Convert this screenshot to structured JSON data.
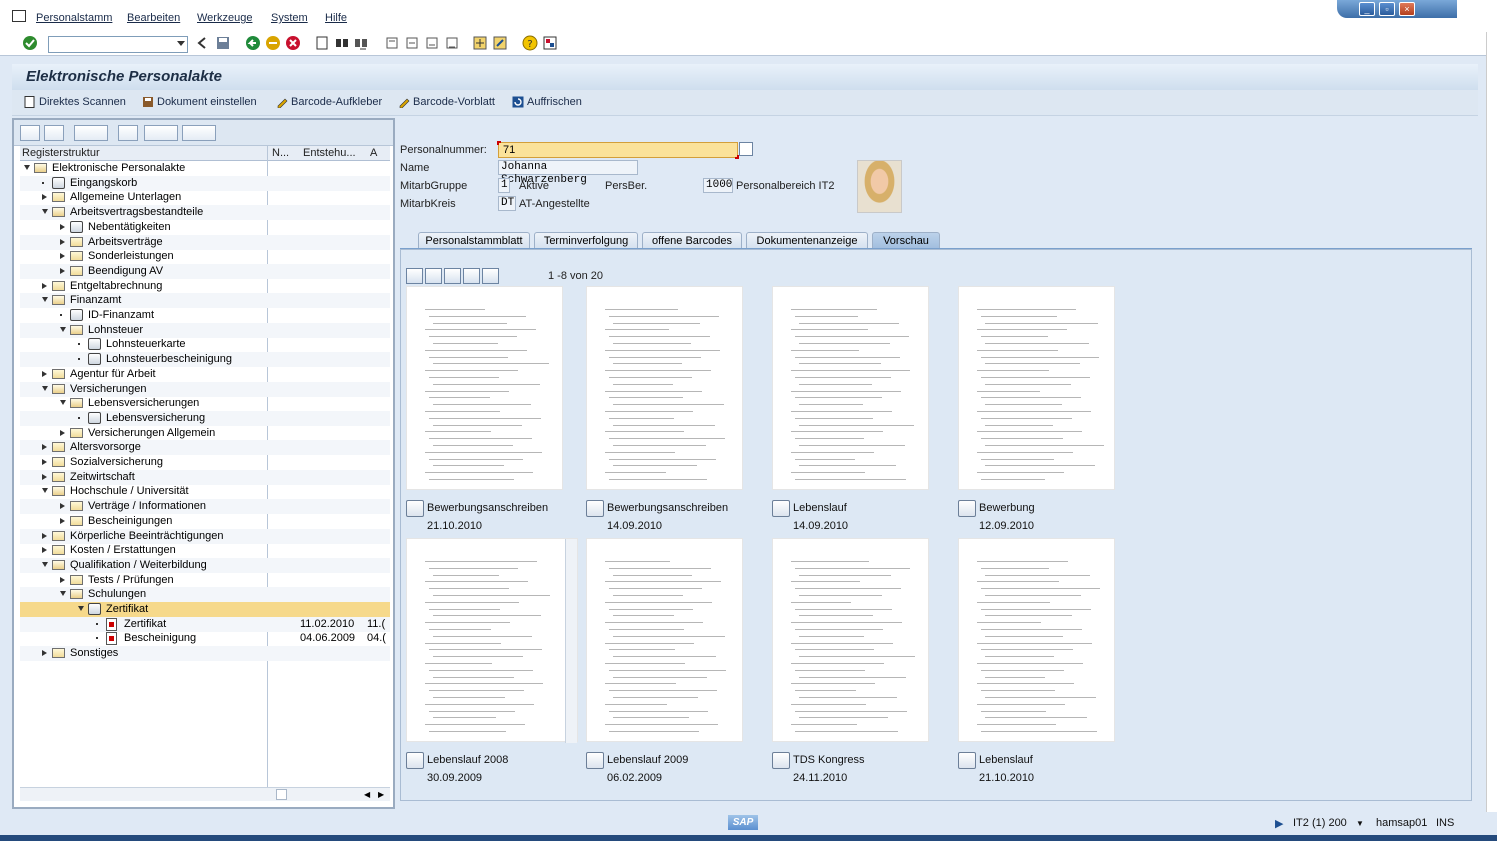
{
  "menu": {
    "items": [
      "Personalstamm",
      "Bearbeiten",
      "Werkzeuge",
      "System",
      "Hilfe"
    ]
  },
  "window_controls": [
    "minimize-icon",
    "restore-icon",
    "close-icon"
  ],
  "toolbar": {
    "command_field_value": "",
    "icons": [
      "enter-icon",
      "back-icon",
      "save-icon",
      "back-green-icon",
      "exit-icon",
      "cancel-icon",
      "print-icon",
      "find-icon",
      "find-next-icon",
      "first-page-icon",
      "prev-page-icon",
      "next-page-icon",
      "last-page-icon",
      "create-session-icon",
      "shortcut-icon",
      "help-icon",
      "layout-icon"
    ]
  },
  "title": "Elektronische Personalakte",
  "app_toolbar": {
    "direct_scan": "Direktes Scannen",
    "upload_document": "Dokument einstellen",
    "barcode_sticker": "Barcode-Aufkleber",
    "barcode_sheet": "Barcode-Vorblatt",
    "refresh": "Auffrischen"
  },
  "tree": {
    "headers": {
      "structure": "Registerstruktur",
      "n": "N...",
      "created": "Entstehu...",
      "a": "A"
    },
    "rows": [
      {
        "level": 0,
        "label": "Elektronische Personalakte",
        "state": "open",
        "icon": "folder-open",
        "date": "",
        "extra": ""
      },
      {
        "level": 1,
        "label": "Eingangskorb",
        "state": "dot",
        "icon": "package",
        "date": "",
        "extra": ""
      },
      {
        "level": 1,
        "label": "Allgemeine Unterlagen",
        "state": "closed",
        "icon": "folder",
        "date": "",
        "extra": ""
      },
      {
        "level": 1,
        "label": "Arbeitsvertragsbestandteile",
        "state": "open",
        "icon": "folder-open",
        "date": "",
        "extra": ""
      },
      {
        "level": 2,
        "label": "Nebentätigkeiten",
        "state": "closed",
        "icon": "package",
        "date": "",
        "extra": ""
      },
      {
        "level": 2,
        "label": "Arbeitsverträge",
        "state": "closed",
        "icon": "folder",
        "date": "",
        "extra": ""
      },
      {
        "level": 2,
        "label": "Sonderleistungen",
        "state": "closed",
        "icon": "folder",
        "date": "",
        "extra": ""
      },
      {
        "level": 2,
        "label": "Beendigung AV",
        "state": "closed",
        "icon": "folder",
        "date": "",
        "extra": ""
      },
      {
        "level": 1,
        "label": "Entgeltabrechnung",
        "state": "closed",
        "icon": "folder",
        "date": "",
        "extra": ""
      },
      {
        "level": 1,
        "label": "Finanzamt",
        "state": "open",
        "icon": "folder-open",
        "date": "",
        "extra": ""
      },
      {
        "level": 2,
        "label": "ID-Finanzamt",
        "state": "dot",
        "icon": "package",
        "date": "",
        "extra": ""
      },
      {
        "level": 2,
        "label": "Lohnsteuer",
        "state": "open",
        "icon": "folder-open",
        "date": "",
        "extra": ""
      },
      {
        "level": 3,
        "label": "Lohnsteuerkarte",
        "state": "dot",
        "icon": "package",
        "date": "",
        "extra": ""
      },
      {
        "level": 3,
        "label": "Lohnsteuerbescheinigung",
        "state": "dot",
        "icon": "package",
        "date": "",
        "extra": ""
      },
      {
        "level": 1,
        "label": "Agentur für Arbeit",
        "state": "closed",
        "icon": "folder",
        "date": "",
        "extra": ""
      },
      {
        "level": 1,
        "label": "Versicherungen",
        "state": "open",
        "icon": "folder-open",
        "date": "",
        "extra": ""
      },
      {
        "level": 2,
        "label": "Lebensversicherungen",
        "state": "open",
        "icon": "folder-open",
        "date": "",
        "extra": ""
      },
      {
        "level": 3,
        "label": "Lebensversicherung",
        "state": "dot",
        "icon": "package",
        "date": "",
        "extra": ""
      },
      {
        "level": 2,
        "label": "Versicherungen Allgemein",
        "state": "closed",
        "icon": "folder",
        "date": "",
        "extra": ""
      },
      {
        "level": 1,
        "label": "Altersvorsorge",
        "state": "closed",
        "icon": "folder",
        "date": "",
        "extra": ""
      },
      {
        "level": 1,
        "label": "Sozialversicherung",
        "state": "closed",
        "icon": "folder",
        "date": "",
        "extra": ""
      },
      {
        "level": 1,
        "label": "Zeitwirtschaft",
        "state": "closed",
        "icon": "folder",
        "date": "",
        "extra": ""
      },
      {
        "level": 1,
        "label": "Hochschule / Universität",
        "state": "open",
        "icon": "folder-open",
        "date": "",
        "extra": ""
      },
      {
        "level": 2,
        "label": "Verträge / Informationen",
        "state": "closed",
        "icon": "folder",
        "date": "",
        "extra": ""
      },
      {
        "level": 2,
        "label": "Bescheinigungen",
        "state": "closed",
        "icon": "folder",
        "date": "",
        "extra": ""
      },
      {
        "level": 1,
        "label": "Körperliche Beeinträchtigungen",
        "state": "closed",
        "icon": "folder",
        "date": "",
        "extra": ""
      },
      {
        "level": 1,
        "label": "Kosten / Erstattungen",
        "state": "closed",
        "icon": "folder",
        "date": "",
        "extra": ""
      },
      {
        "level": 1,
        "label": "Qualifikation / Weiterbildung",
        "state": "open",
        "icon": "folder-open",
        "date": "",
        "extra": ""
      },
      {
        "level": 2,
        "label": "Tests / Prüfungen",
        "state": "closed",
        "icon": "folder",
        "date": "",
        "extra": ""
      },
      {
        "level": 2,
        "label": "Schulungen",
        "state": "open",
        "icon": "folder-open",
        "date": "",
        "extra": ""
      },
      {
        "level": 3,
        "label": "Zertifikat",
        "state": "open",
        "icon": "package",
        "date": "",
        "extra": "",
        "selected": true
      },
      {
        "level": 4,
        "label": "Zertifikat",
        "state": "dot",
        "icon": "document",
        "date": "11.02.2010",
        "extra": "11.("
      },
      {
        "level": 4,
        "label": "Bescheinigung",
        "state": "dot",
        "icon": "document",
        "date": "04.06.2009",
        "extra": "04.("
      },
      {
        "level": 1,
        "label": "Sonstiges",
        "state": "closed",
        "icon": "folder",
        "date": "",
        "extra": ""
      }
    ]
  },
  "header_fields": {
    "pernr_label": "Personalnummer:",
    "pernr_value": "71",
    "name_label": "Name",
    "name_value": "Johanna Schwarzenberg",
    "group_label": "MitarbGruppe",
    "group_code": "1",
    "group_text": "Aktive",
    "persber_label": "PersBer.",
    "persber_code": "1000",
    "persber_text": "Personalbereich IT2",
    "circle_label": "MitarbKreis",
    "circle_code": "DT",
    "circle_text": "AT-Angestellte"
  },
  "tabs": [
    "Personalstammblatt",
    "Terminverfolgung",
    "offene Barcodes",
    "Dokumentenanzeige",
    "Vorschau"
  ],
  "active_tab": "Vorschau",
  "pager": "1 -8  von  20",
  "thumbnails": [
    {
      "title": "Bewerbungsanschreiben",
      "date": "21.10.2010"
    },
    {
      "title": "Bewerbungsanschreiben",
      "date": "14.09.2010"
    },
    {
      "title": "Lebenslauf",
      "date": "14.09.2010"
    },
    {
      "title": "Bewerbung",
      "date": "12.09.2010"
    },
    {
      "title": "Lebenslauf 2008",
      "date": "30.09.2009"
    },
    {
      "title": "Lebenslauf 2009",
      "date": "06.02.2009"
    },
    {
      "title": "TDS Kongress",
      "date": "24.11.2010"
    },
    {
      "title": "Lebenslauf",
      "date": "21.10.2010"
    }
  ],
  "status": {
    "system": "IT2 (1) 200",
    "server": "hamsap01",
    "mode": "INS"
  },
  "colors": {
    "selected_row": "#f6d98b",
    "required_field": "#fbe29a",
    "active_tab": "#9fbcdd"
  }
}
